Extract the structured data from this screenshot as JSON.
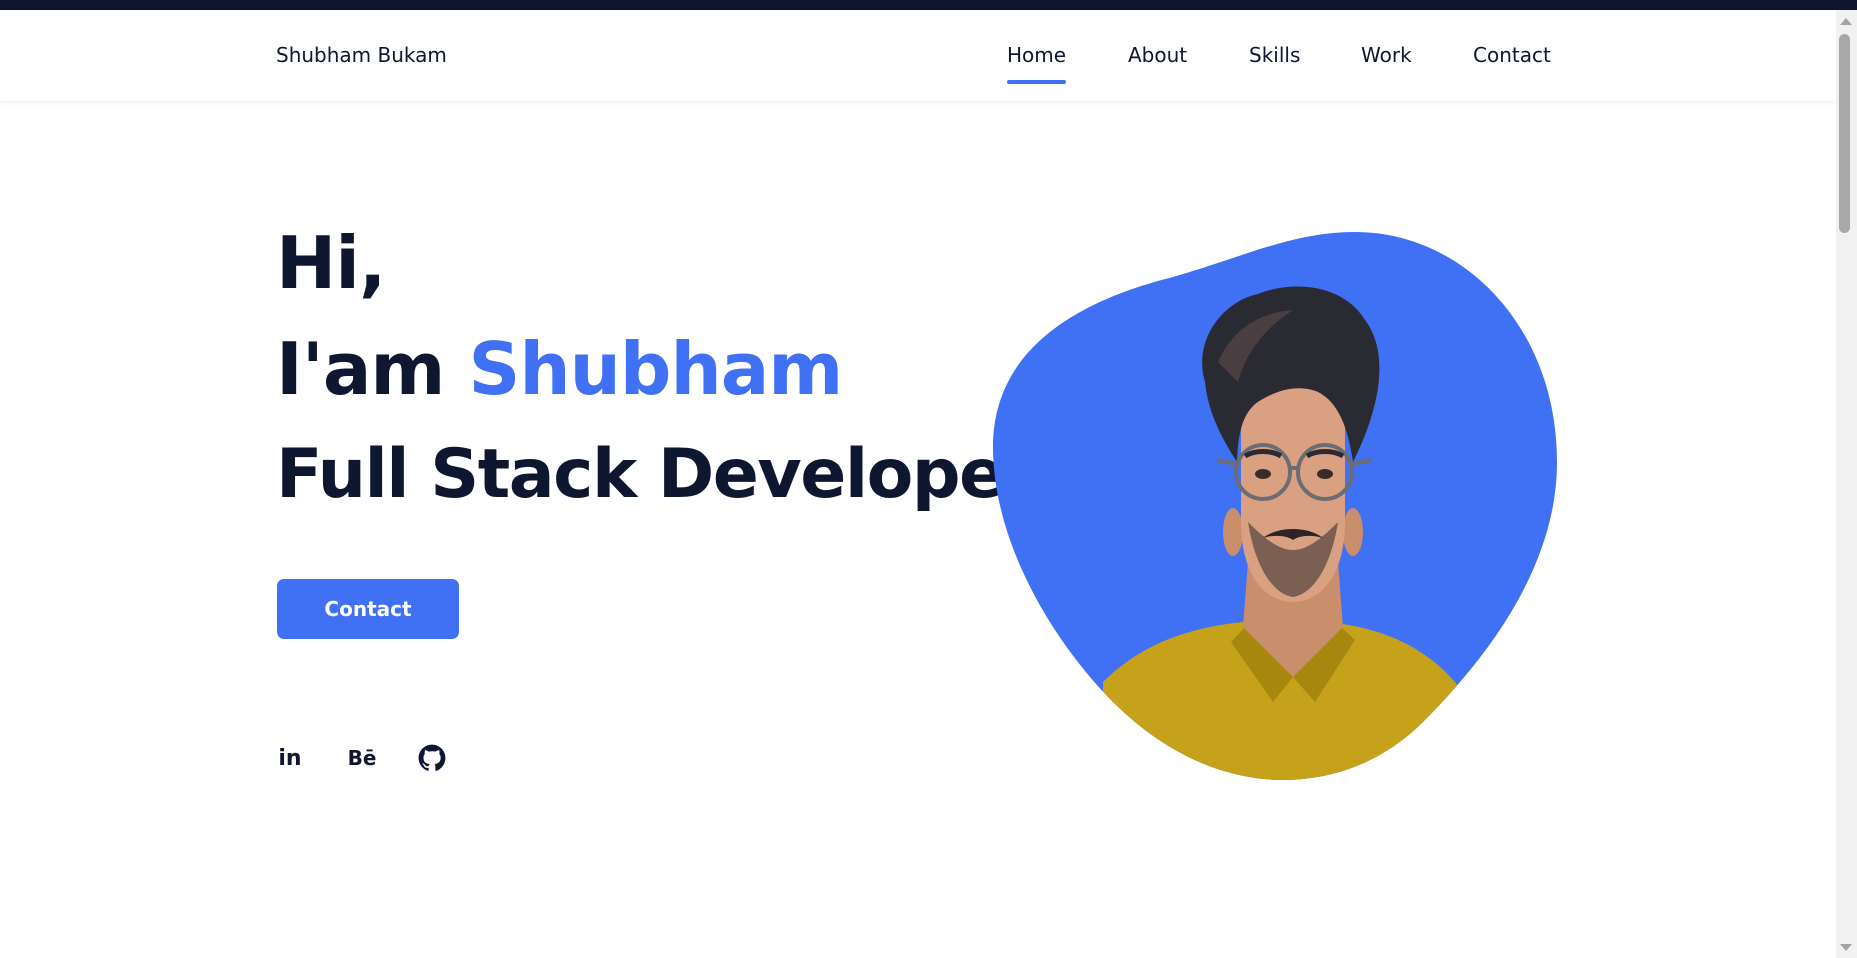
{
  "brand": {
    "name": "Shubham Bukam"
  },
  "nav": {
    "items": [
      {
        "label": "Home",
        "active": true
      },
      {
        "label": "About",
        "active": false
      },
      {
        "label": "Skills",
        "active": false
      },
      {
        "label": "Work",
        "active": false
      },
      {
        "label": "Contact",
        "active": false
      }
    ]
  },
  "hero": {
    "greeting": "Hi,",
    "intro_prefix": "I'am",
    "name": "Shubham",
    "role": "Full Stack Developer"
  },
  "cta": {
    "label": "Contact"
  },
  "social": {
    "items": [
      {
        "icon": "linkedin-icon",
        "glyph": "in"
      },
      {
        "icon": "behance-icon",
        "glyph": "Bē"
      },
      {
        "icon": "github-icon",
        "glyph": ""
      }
    ]
  },
  "colors": {
    "accent": "#4070f4",
    "text": "#0e1630",
    "topbar": "#0e1630",
    "button_text": "#ffffff"
  }
}
